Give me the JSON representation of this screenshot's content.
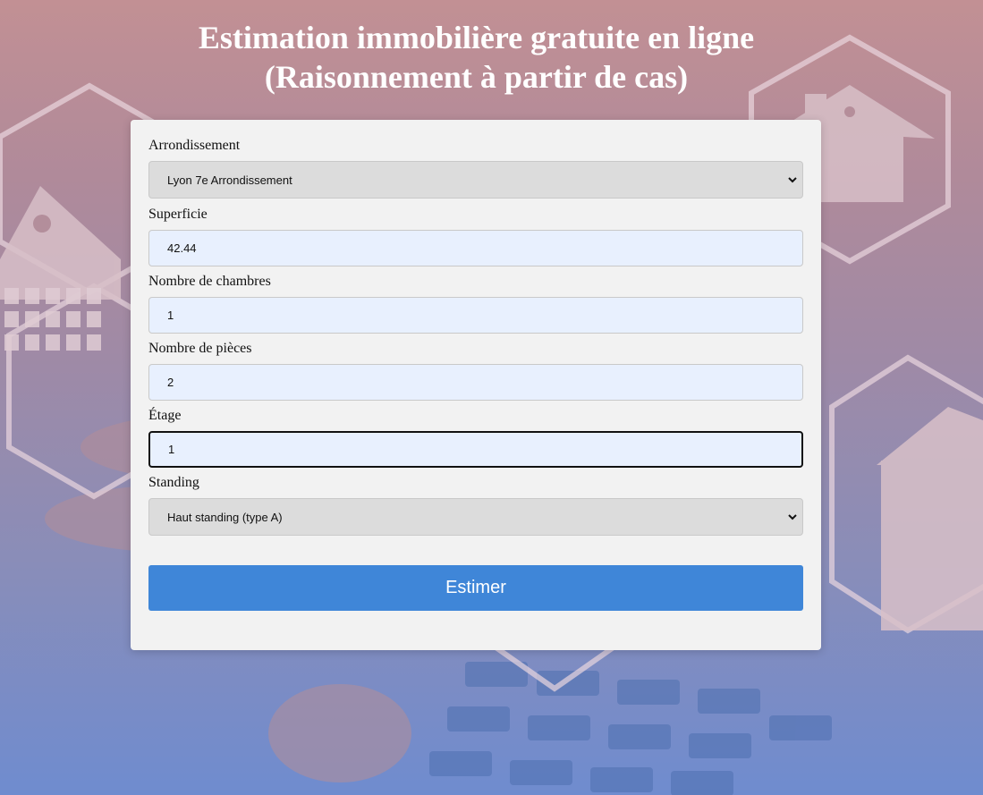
{
  "header": {
    "title_line1": "Estimation immobilière gratuite en ligne",
    "title_line2": "(Raisonnement à partir de cas)"
  },
  "form": {
    "arrondissement": {
      "label": "Arrondissement",
      "value": "Lyon 7e Arrondissement"
    },
    "superficie": {
      "label": "Superficie",
      "value": "42.44"
    },
    "chambres": {
      "label": "Nombre de chambres",
      "value": "1"
    },
    "pieces": {
      "label": "Nombre de pièces",
      "value": "2"
    },
    "etage": {
      "label": "Étage",
      "value": "1"
    },
    "standing": {
      "label": "Standing",
      "value": "Haut standing (type A)"
    },
    "submit_label": "Estimer"
  },
  "colors": {
    "button": "#3f86d8",
    "card": "#f2f2f2",
    "input_fill": "#e8f0fe",
    "select_fill": "#dcdcdc"
  },
  "icons": [
    "house-icon",
    "hexagon-outline",
    "chevron-down-icon"
  ]
}
